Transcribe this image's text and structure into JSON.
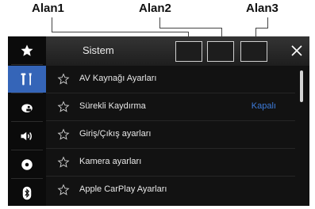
{
  "callouts": [
    "Alan1",
    "Alan2",
    "Alan3"
  ],
  "header": {
    "title": "Sistem"
  },
  "sidebar": {
    "items": [
      {
        "icon": "star-icon",
        "active": false
      },
      {
        "icon": "tools-icon",
        "active": true
      },
      {
        "icon": "theme-palette-icon",
        "active": false
      },
      {
        "icon": "speaker-volume-icon",
        "active": false
      },
      {
        "icon": "disc-icon",
        "active": false
      },
      {
        "icon": "bluetooth-icon",
        "active": false
      }
    ]
  },
  "list": {
    "items": [
      {
        "label": "AV Kaynağı Ayarları",
        "value": ""
      },
      {
        "label": "Sürekli Kaydırma",
        "value": "Kapalı"
      },
      {
        "label": "Giriş/Çıkış ayarları",
        "value": ""
      },
      {
        "label": "Kamera ayarları",
        "value": ""
      },
      {
        "label": "Apple CarPlay Ayarları",
        "value": ""
      }
    ]
  },
  "colors": {
    "accent": "#3565b8",
    "value_text": "#3d7bd9",
    "background": "#0b0b0b"
  }
}
